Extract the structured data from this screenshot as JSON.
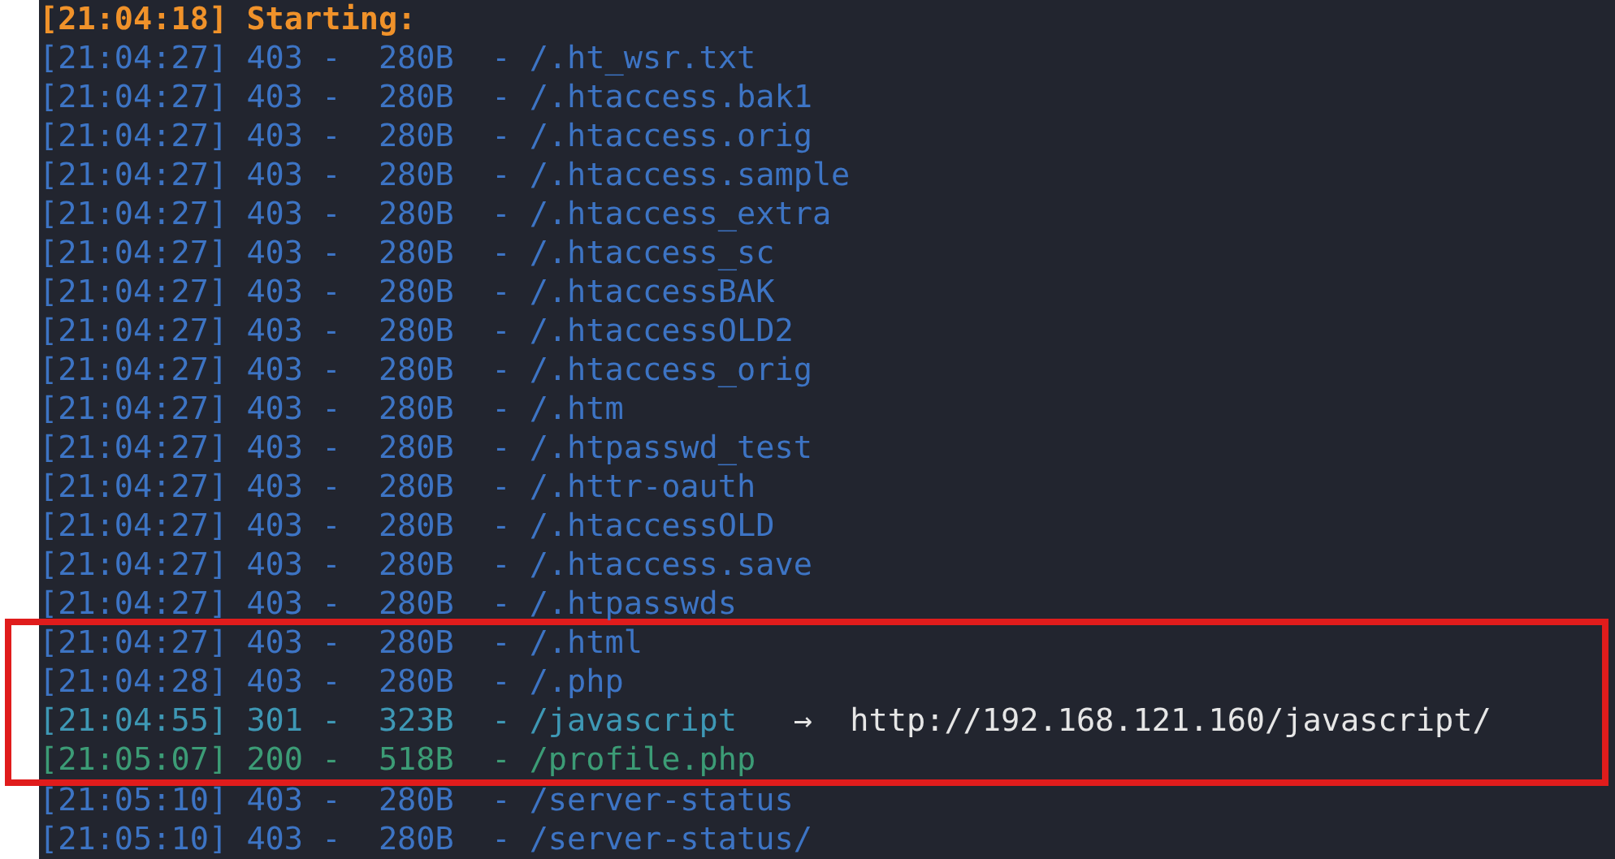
{
  "header": {
    "text": "[21:04:18] Starting:"
  },
  "lines": [
    {
      "kind": "forbidden",
      "text": "[21:04:27] 403 -  280B  - /.ht_wsr.txt"
    },
    {
      "kind": "forbidden",
      "text": "[21:04:27] 403 -  280B  - /.htaccess.bak1"
    },
    {
      "kind": "forbidden",
      "text": "[21:04:27] 403 -  280B  - /.htaccess.orig"
    },
    {
      "kind": "forbidden",
      "text": "[21:04:27] 403 -  280B  - /.htaccess.sample"
    },
    {
      "kind": "forbidden",
      "text": "[21:04:27] 403 -  280B  - /.htaccess_extra"
    },
    {
      "kind": "forbidden",
      "text": "[21:04:27] 403 -  280B  - /.htaccess_sc"
    },
    {
      "kind": "forbidden",
      "text": "[21:04:27] 403 -  280B  - /.htaccessBAK"
    },
    {
      "kind": "forbidden",
      "text": "[21:04:27] 403 -  280B  - /.htaccessOLD2"
    },
    {
      "kind": "forbidden",
      "text": "[21:04:27] 403 -  280B  - /.htaccess_orig"
    },
    {
      "kind": "forbidden",
      "text": "[21:04:27] 403 -  280B  - /.htm"
    },
    {
      "kind": "forbidden",
      "text": "[21:04:27] 403 -  280B  - /.htpasswd_test"
    },
    {
      "kind": "forbidden",
      "text": "[21:04:27] 403 -  280B  - /.httr-oauth"
    },
    {
      "kind": "forbidden",
      "text": "[21:04:27] 403 -  280B  - /.htaccessOLD"
    },
    {
      "kind": "forbidden",
      "text": "[21:04:27] 403 -  280B  - /.htaccess.save"
    },
    {
      "kind": "forbidden",
      "text": "[21:04:27] 403 -  280B  - /.htpasswds"
    }
  ],
  "highlighted_lines": [
    {
      "kind": "forbidden",
      "text": "[21:04:27] 403 -  280B  - /.html"
    },
    {
      "kind": "forbidden",
      "text": "[21:04:28] 403 -  280B  - /.php"
    },
    {
      "kind": "redirect",
      "text": "[21:04:55] 301 -  323B  - /javascript",
      "redirect": "→  http://192.168.121.160/javascript/"
    },
    {
      "kind": "ok",
      "text": "[21:05:07] 200 -  518B  - /profile.php"
    }
  ],
  "more_lines": [
    {
      "kind": "forbidden",
      "text": "[21:05:10] 403 -  280B  - /server-status"
    },
    {
      "kind": "forbidden",
      "text": "[21:05:10] 403 -  280B  - /server-status/"
    }
  ]
}
